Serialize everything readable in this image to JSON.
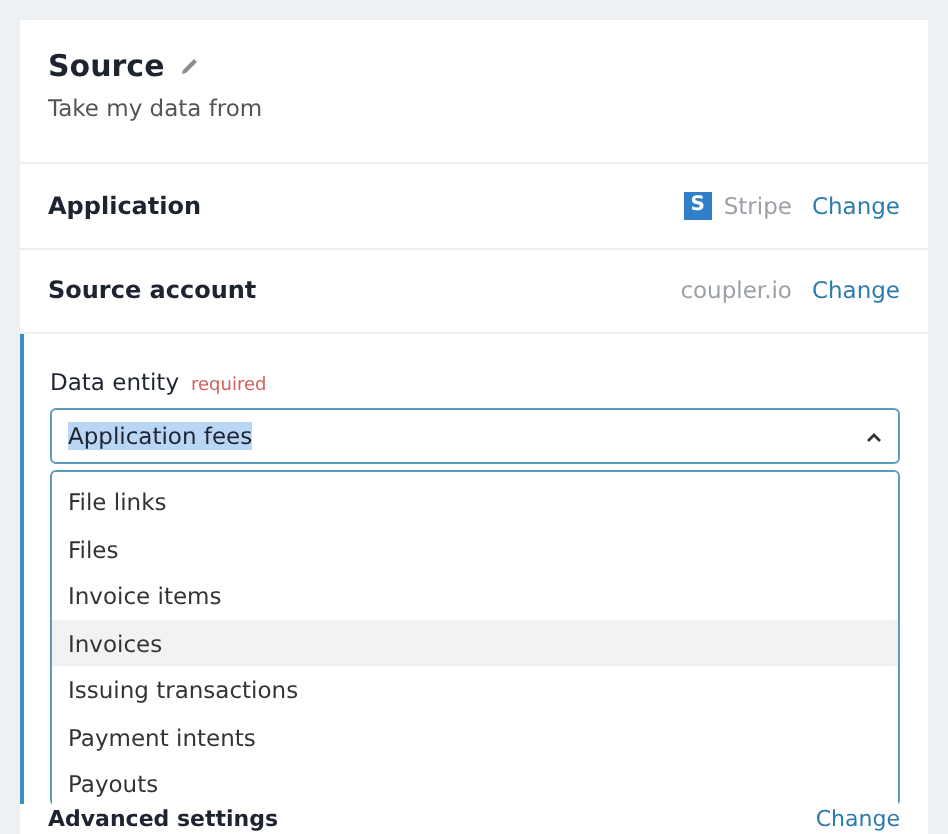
{
  "header": {
    "title": "Source",
    "subtitle": "Take my data from"
  },
  "rows": [
    {
      "label": "Application",
      "value": "Stripe",
      "logo_letter": "S",
      "action": "Change"
    },
    {
      "label": "Source account",
      "value": "coupler.io",
      "action": "Change"
    }
  ],
  "data_entity": {
    "label": "Data entity",
    "required": "required",
    "value": "Application fees",
    "expanded": true,
    "options": [
      {
        "label": "File links",
        "selected": false
      },
      {
        "label": "Files",
        "selected": false
      },
      {
        "label": "Invoice items",
        "selected": false
      },
      {
        "label": "Invoices",
        "selected": true
      },
      {
        "label": "Issuing transactions",
        "selected": false
      },
      {
        "label": "Payment intents",
        "selected": false
      },
      {
        "label": "Payouts",
        "selected": false
      }
    ]
  },
  "advanced": {
    "label": "Advanced settings",
    "action": "Change"
  }
}
